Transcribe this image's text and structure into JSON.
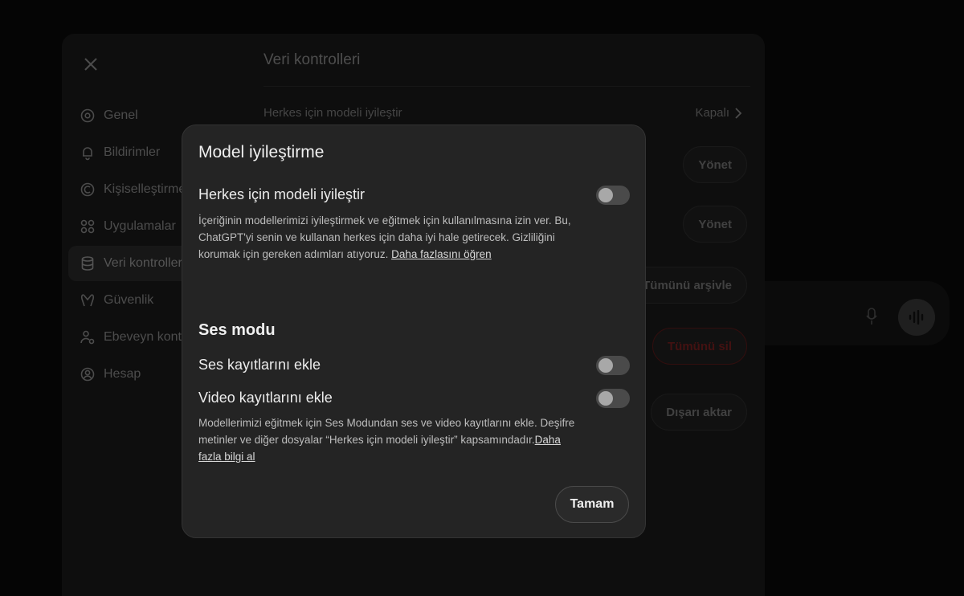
{
  "settings": {
    "nav": [
      {
        "label": "Genel",
        "icon": "gear-icon"
      },
      {
        "label": "Bildirimler",
        "icon": "bell-icon"
      },
      {
        "label": "Kişiselleştirme",
        "icon": "personalization-icon"
      },
      {
        "label": "Uygulamalar",
        "icon": "apps-icon"
      },
      {
        "label": "Veri kontrolleri",
        "icon": "database-icon"
      },
      {
        "label": "Güvenlik",
        "icon": "security-icon"
      },
      {
        "label": "Ebeveyn kontrolleri",
        "icon": "parental-icon"
      },
      {
        "label": "Hesap",
        "icon": "account-icon"
      }
    ],
    "active_index": 4,
    "title": "Veri kontrolleri",
    "rows": {
      "improve_label": "Herkes için modeli iyileştir",
      "improve_value": "Kapalı",
      "manage_1": "Yönet",
      "manage_2": "Yönet",
      "archive_all": "Tümünü arşivle",
      "delete_all": "Tümünü sil",
      "export": "Dışarı aktar"
    }
  },
  "modal": {
    "title": "Model iyileştirme",
    "improve": {
      "label": "Herkes için modeli iyileştir",
      "desc": "İçeriğinin modellerimizi iyileştirmek ve eğitmek için kullanılmasına izin ver. Bu, ChatGPT'yi senin ve kullanan herkes için daha iyi hale getirecek. Gizliliğini korumak için gereken adımları atıyoruz. ",
      "link": "Daha fazlasını öğren",
      "enabled": false
    },
    "voice_section": "Ses modu",
    "audio": {
      "label": "Ses kayıtlarını ekle",
      "enabled": false
    },
    "video": {
      "label": "Video kayıtlarını ekle",
      "enabled": false
    },
    "voice_desc": "Modellerimizi eğitmek için Ses Modundan ses ve video kayıtlarını ekle. Deşifre metinler ve diğer dosyalar “Herkes için modeli iyileştir” kapsamındadır.",
    "voice_link": "Daha fazla bilgi al",
    "ok_label": "Tamam"
  }
}
